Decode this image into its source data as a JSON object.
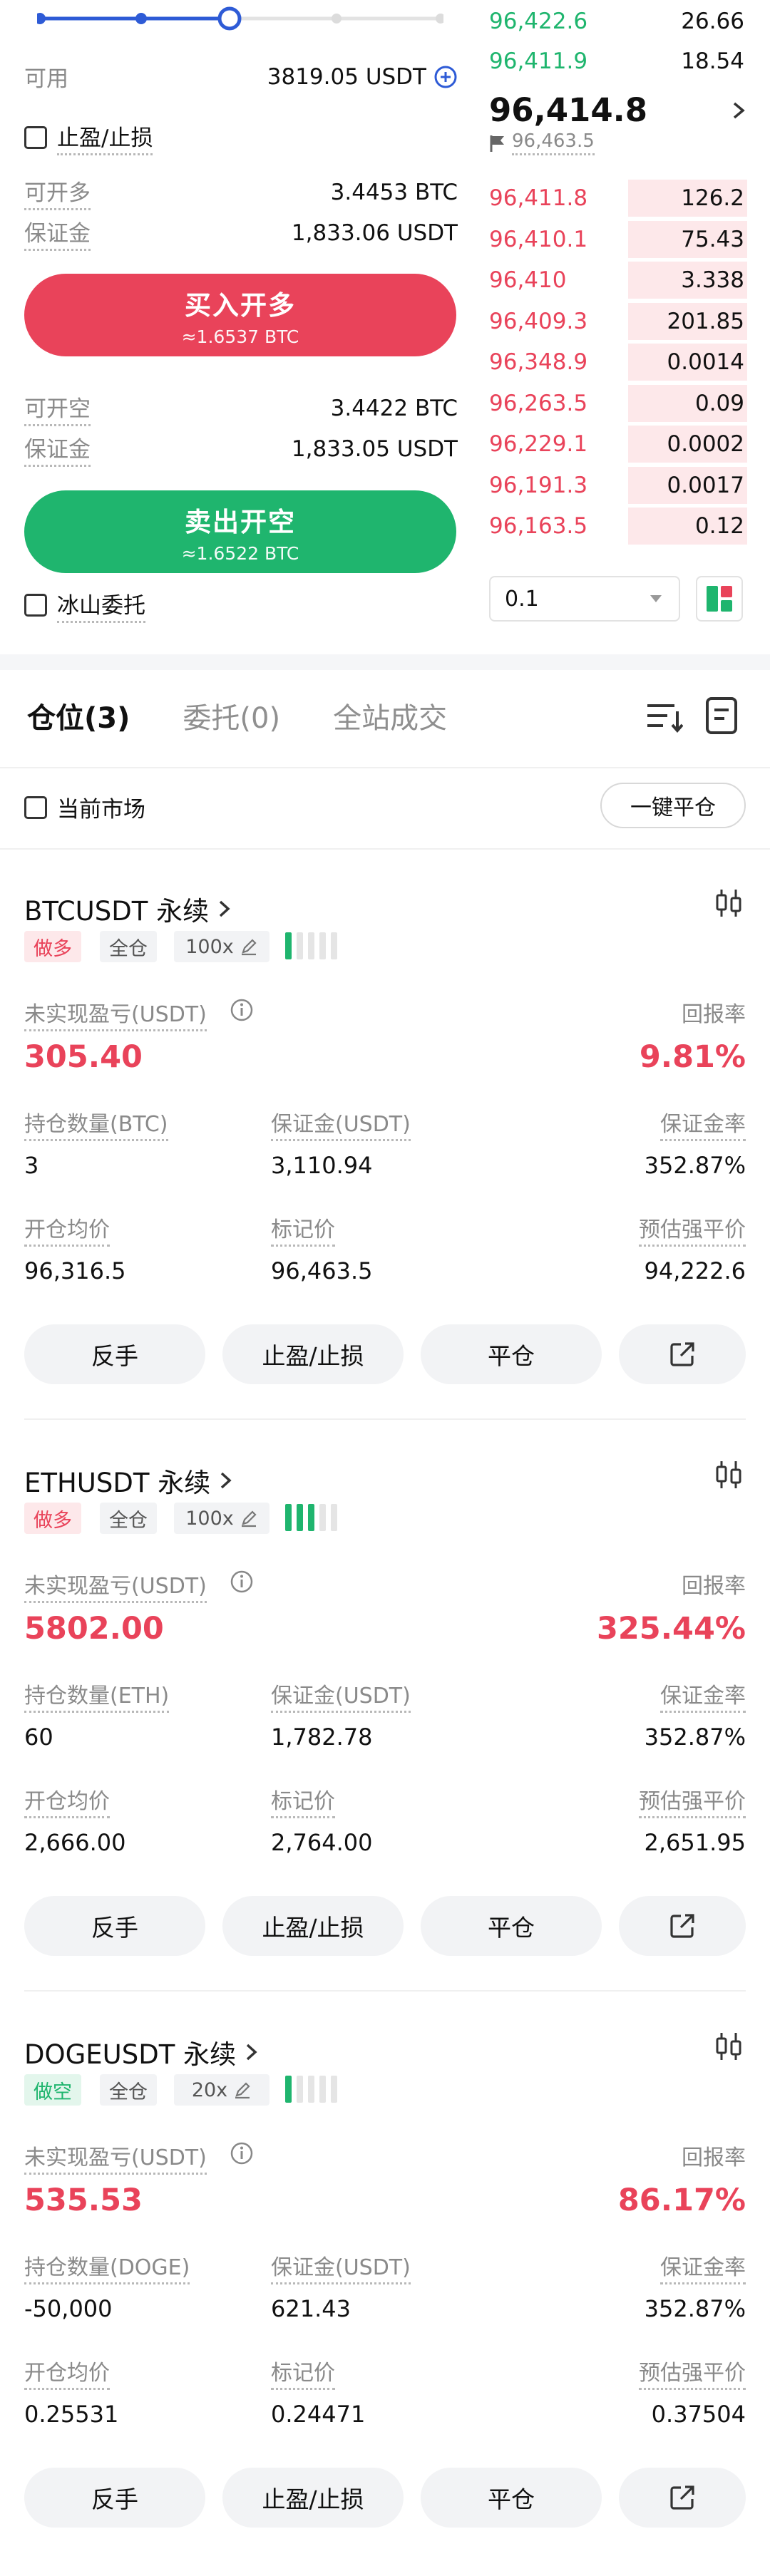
{
  "order_form": {
    "available_label": "可用",
    "available_value": "3819.05 USDT",
    "tp_sl_label": "止盈/止损",
    "long_max_label": "可开多",
    "long_max_value": "3.4453 BTC",
    "long_margin_label": "保证金",
    "long_margin_value": "1,833.06 USDT",
    "buy_button": "买入开多",
    "buy_sub": "≈1.6537 BTC",
    "short_max_label": "可开空",
    "short_max_value": "3.4422 BTC",
    "short_margin_label": "保证金",
    "short_margin_value": "1,833.05 USDT",
    "sell_button": "卖出开空",
    "sell_sub": "≈1.6522 BTC",
    "iceberg_label": "冰山委托",
    "slider_level": 0.5
  },
  "order_book": {
    "top_bids": [
      {
        "price": "96,422.6",
        "qty": "26.66"
      },
      {
        "price": "96,411.9",
        "qty": "18.54"
      }
    ],
    "last_price": "96,414.8",
    "mark_price": "96,463.5",
    "asks": [
      {
        "price": "96,411.8",
        "qty": "126.2",
        "depth": 0.46
      },
      {
        "price": "96,410.1",
        "qty": "75.43",
        "depth": 0.46
      },
      {
        "price": "96,410",
        "qty": "3.338",
        "depth": 0.46
      },
      {
        "price": "96,409.3",
        "qty": "201.85",
        "depth": 0.46
      },
      {
        "price": "96,348.9",
        "qty": "0.0014",
        "depth": 0.46
      },
      {
        "price": "96,263.5",
        "qty": "0.09",
        "depth": 0.46
      },
      {
        "price": "96,229.1",
        "qty": "0.0002",
        "depth": 0.46
      },
      {
        "price": "96,191.3",
        "qty": "0.0017",
        "depth": 0.46
      },
      {
        "price": "96,163.5",
        "qty": "0.12",
        "depth": 0.46
      }
    ],
    "precision": "0.1"
  },
  "tabs": [
    {
      "label": "仓位(3)"
    },
    {
      "label": "委托(0)"
    },
    {
      "label": "全站成交"
    }
  ],
  "filter": {
    "current_market_label": "当前市场",
    "close_all_button": "一键平仓"
  },
  "labels": {
    "unrealized_pnl": "未实现盈亏(USDT)",
    "roe": "回报率",
    "margin": "保证金(USDT)",
    "margin_ratio": "保证金率",
    "entry_price": "开仓均价",
    "mark_price": "标记价",
    "liq_price": "预估强平价",
    "cross": "全仓",
    "reverse": "反手",
    "tp_sl": "止盈/止损",
    "close": "平仓"
  },
  "positions": [
    {
      "symbol": "BTCUSDT 永续",
      "side": "做多",
      "leverage": "100x",
      "pnl": "305.40",
      "roe": "9.81%",
      "size_label": "持仓数量(BTC)",
      "size": "3",
      "margin": "3,110.94",
      "margin_ratio": "352.87%",
      "entry": "96,316.5",
      "mark": "96,463.5",
      "liq": "94,222.6"
    },
    {
      "symbol": "ETHUSDT 永续",
      "side": "做多",
      "leverage": "100x",
      "pnl": "5802.00",
      "roe": "325.44%",
      "size_label": "持仓数量(ETH)",
      "size": "60",
      "margin": "1,782.78",
      "margin_ratio": "352.87%",
      "entry": "2,666.00",
      "mark": "2,764.00",
      "liq": "2,651.95"
    },
    {
      "symbol": "DOGEUSDT 永续",
      "side": "做空",
      "leverage": "20x",
      "pnl": "535.53",
      "roe": "86.17%",
      "size_label": "持仓数量(DOGE)",
      "size": "-50,000",
      "margin": "621.43",
      "margin_ratio": "352.87%",
      "entry": "0.25531",
      "mark": "0.24471",
      "liq": "0.37504"
    }
  ],
  "colors": {
    "red": "#e9435a",
    "green": "#1fb56e",
    "blue": "#2e5bd6"
  }
}
